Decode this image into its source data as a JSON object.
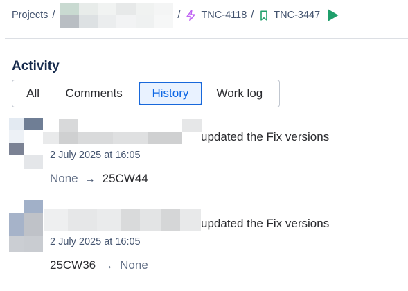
{
  "breadcrumb": {
    "projects_label": "Projects",
    "separator": "/",
    "parent_issue_key": "TNC-4118",
    "issue_key": "TNC-3447"
  },
  "activity": {
    "title": "Activity",
    "tabs": [
      {
        "label": "All",
        "selected": false
      },
      {
        "label": "Comments",
        "selected": false
      },
      {
        "label": "History",
        "selected": true
      },
      {
        "label": "Work log",
        "selected": false
      }
    ]
  },
  "history": [
    {
      "action": "updated the Fix versions",
      "timestamp": "2 July 2025 at 16:05",
      "from": "None",
      "to": "25CW44",
      "arrow": "→"
    },
    {
      "action": "updated the Fix versions",
      "timestamp": "2 July 2025 at 16:05",
      "from": "25CW36",
      "to": "None",
      "arrow": "→"
    }
  ],
  "colors": {
    "accent": "#1868db",
    "selected_tab_bg": "#e9f2ff",
    "parent_icon": "#bf63f3",
    "issue_icon": "#22a06b",
    "play_icon": "#1f9f6b"
  },
  "icons": {
    "parent": "lightning-icon",
    "issue": "bookmark-icon",
    "run": "play-icon"
  }
}
